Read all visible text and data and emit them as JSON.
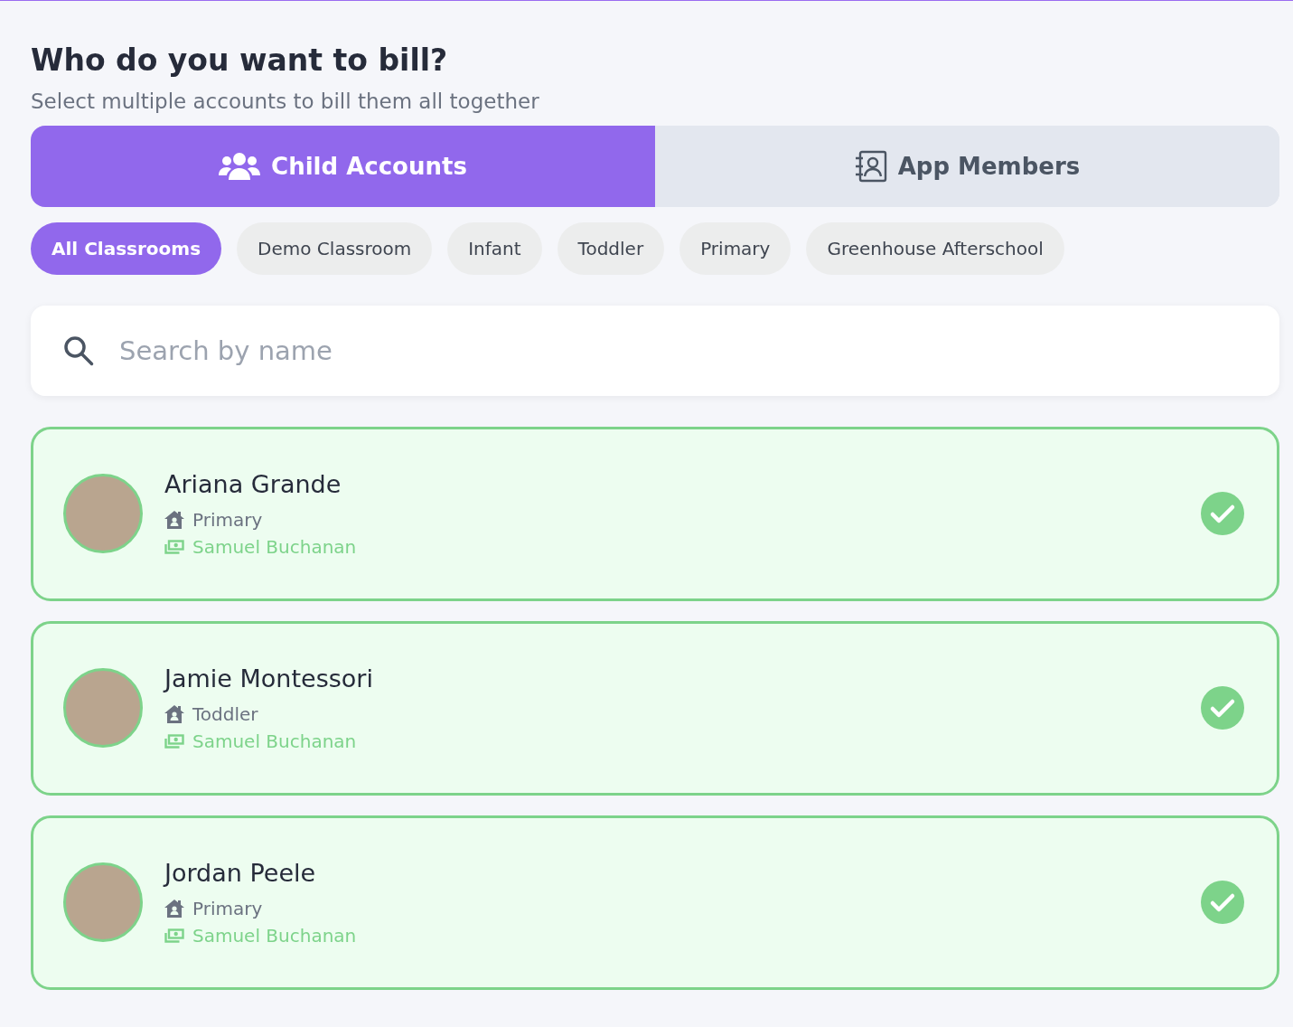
{
  "header": {
    "title": "Who do you want to bill?",
    "subtitle": "Select multiple accounts to bill them all together"
  },
  "tabs": [
    {
      "label": "Child Accounts",
      "kind": "group",
      "selected": true
    },
    {
      "label": "App Members",
      "kind": "contacts",
      "selected": false
    }
  ],
  "classroom_filters": [
    {
      "label": "All Classrooms",
      "selected": true
    },
    {
      "label": "Demo Classroom",
      "selected": false
    },
    {
      "label": "Infant",
      "selected": false
    },
    {
      "label": "Toddler",
      "selected": false
    },
    {
      "label": "Primary",
      "selected": false
    },
    {
      "label": "Greenhouse Afterschool",
      "selected": false
    }
  ],
  "search": {
    "placeholder": "Search by name"
  },
  "accounts": [
    {
      "name": "Ariana Grande",
      "classroom": "Primary",
      "payer": "Samuel Buchanan",
      "selected": true
    },
    {
      "name": "Jamie Montessori",
      "classroom": "Toddler",
      "payer": "Samuel Buchanan",
      "selected": true
    },
    {
      "name": "Jordan Peele",
      "classroom": "Primary",
      "payer": "Samuel Buchanan",
      "selected": true
    }
  ]
}
